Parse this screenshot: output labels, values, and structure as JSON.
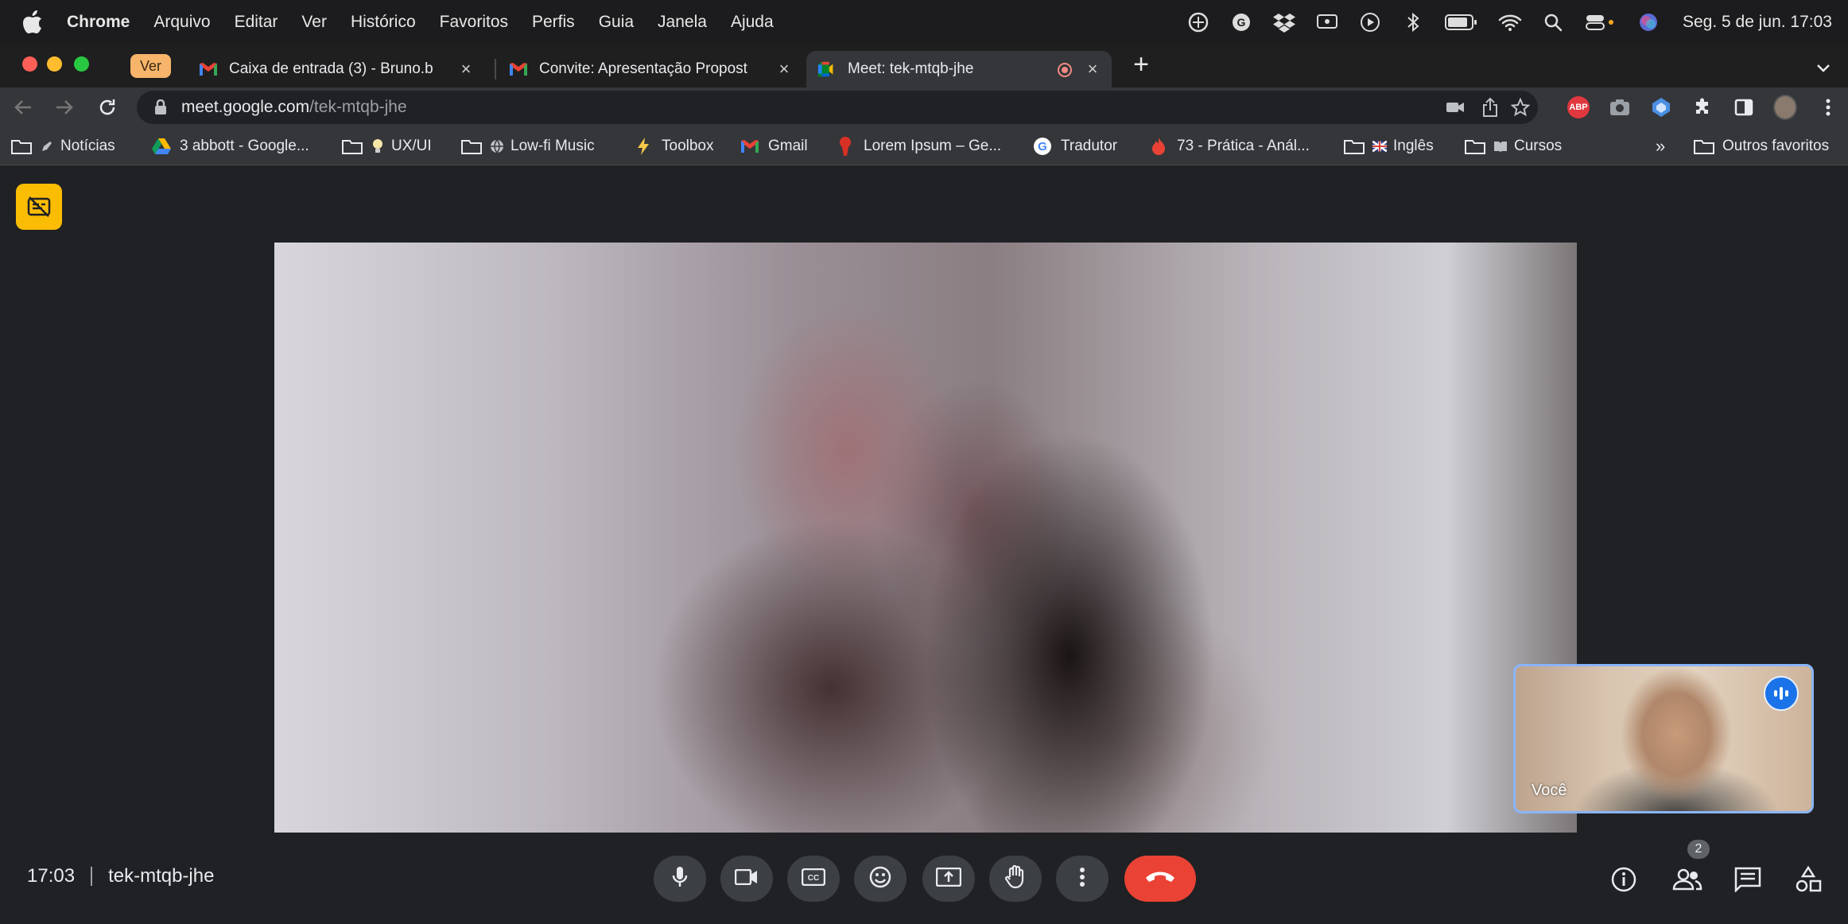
{
  "menubar": {
    "app": "Chrome",
    "items": [
      "Arquivo",
      "Editar",
      "Ver",
      "Histórico",
      "Favoritos",
      "Perfis",
      "Guia",
      "Janela",
      "Ajuda"
    ],
    "clock": "Seg. 5 de jun.  17:03",
    "status_icons": [
      "vpn-icon",
      "grammarly-icon",
      "dropbox-icon",
      "cast-icon",
      "play-icon",
      "bluetooth-icon",
      "battery-icon",
      "wifi-icon",
      "spotlight-icon",
      "control-center-icon",
      "siri-icon"
    ]
  },
  "tabs": {
    "group_label": "Ver",
    "items": [
      {
        "title": "Caixa de entrada (3) - Bruno.b",
        "icon": "gmail-icon",
        "close": "×"
      },
      {
        "title": "Convite: Apresentação Propost",
        "icon": "gmail-icon",
        "close": "×"
      },
      {
        "title": "Meet: tek-mtqb-jhe",
        "icon": "meet-icon",
        "close": "×",
        "active": true
      }
    ],
    "new_tab": "+"
  },
  "toolbar": {
    "url_host": "meet.google.com",
    "url_path": "/tek-mtqb-jhe",
    "abp_label": "ABP"
  },
  "bookmarks": {
    "items": [
      "Notícias",
      "3 abbott - Google...",
      "UX/UI",
      "Low-fi Music",
      "Toolbox",
      "Gmail",
      "Lorem Ipsum – Ge...",
      "Tradutor",
      "73 - Prática - Anál...",
      "Inglês",
      "Cursos"
    ],
    "overflow": "»",
    "other": "Outros favoritos"
  },
  "meet": {
    "self_label": "Você",
    "time": "17:03",
    "meeting_code": "tek-mtqb-jhe",
    "participant_count": "2",
    "colors": {
      "accent": "#8ab4f8",
      "end_call": "#ea4335",
      "captions_badge": "#fbbc04",
      "speaking": "#1a73e8"
    }
  }
}
